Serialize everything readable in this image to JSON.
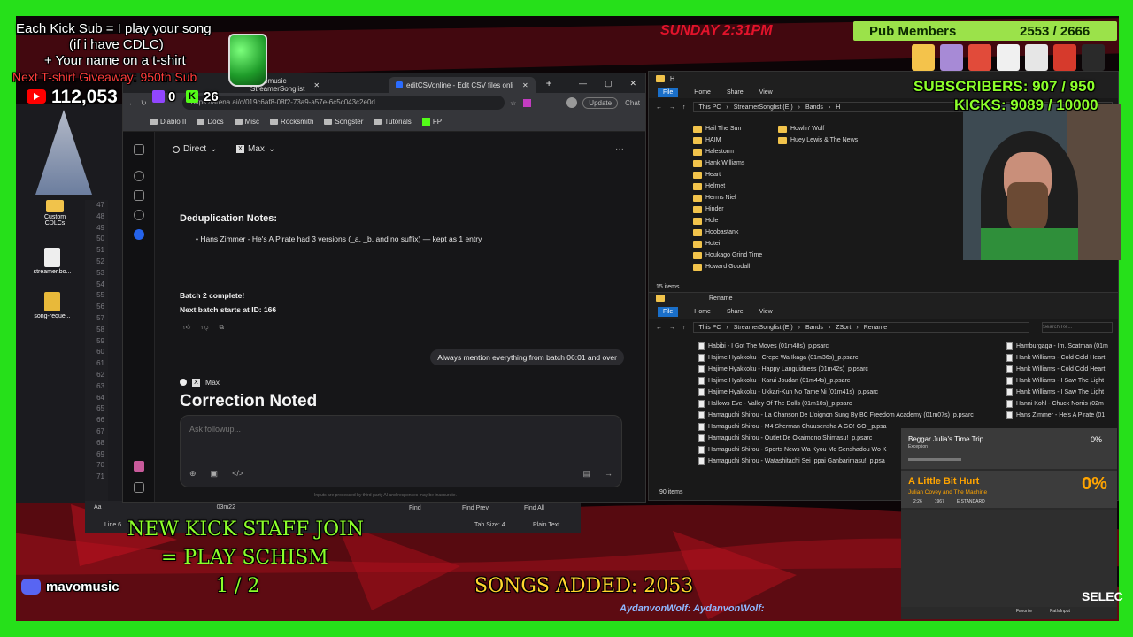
{
  "stream": {
    "kick_sub_line1": "Each Kick Sub = I play your song",
    "kick_sub_line2": "(if i have CDLC)",
    "tshirt_line": "+ Your name on a t-shirt",
    "giveaway_line": "Next T-shirt Giveaway: 950th Sub",
    "youtube_count": "112,053",
    "twitch_count": "0",
    "kick_count": "26",
    "day_time": "SUNDAY 2:31PM",
    "pub_members_label": "Pub Members",
    "pub_members_count": "2553 / 2666",
    "subscribers": "SUBSCRIBERS: 907 / 950",
    "kicks": "KICKS: 9089 / 10000",
    "promo_line1": "NEW KICK STAFF JOIN",
    "promo_line2": "= PLAY SCHISM",
    "promo_line3": "1 / 2",
    "songs_added": "SONGS ADDED: 2053",
    "channel_name": "mavomusic",
    "ticker": "AydanvonWolf: AydanvonWolf:",
    "select_label": "SELEC"
  },
  "desktop": {
    "icons": [
      {
        "label": "Custom CDLCs"
      },
      {
        "label": "streamer.bo..."
      },
      {
        "label": "song-reque..."
      }
    ],
    "editor": {
      "line_numbers": [
        "47",
        "48",
        "49",
        "50",
        "51",
        "52",
        "53",
        "54",
        "55",
        "56",
        "57",
        "58",
        "59",
        "60",
        "61",
        "62",
        "63",
        "64",
        "65",
        "66",
        "67",
        "68",
        "69",
        "70",
        "71"
      ],
      "find_time": "03m22",
      "find_label": "Find",
      "find_prev": "Find Prev",
      "find_all": "Find All",
      "status_line": "Line 6",
      "status_tab": "Tab Size: 4",
      "status_mode": "Plain Text"
    }
  },
  "browser": {
    "tabs": [
      {
        "title": "mavomusic | StreamerSonglist"
      },
      {
        "title": "editCSVonline - Edit CSV files onli"
      }
    ],
    "new_tab": "+",
    "url": "https://arena.ai/c/019c6af8-08f2-73a9-a57e-6c5c043c2e0d",
    "update_label": "Update",
    "chat_label": "Chat",
    "bookmarks": [
      "Diablo II",
      "Docs",
      "Misc",
      "Rocksmith",
      "Songster",
      "Tutorials",
      "FP"
    ],
    "mode_select": "Direct",
    "model_select": "Max",
    "dedup_heading": "Deduplication Notes:",
    "dedup_item": "Hans Zimmer - He's A Pirate had 3 versions (_a, _b, and no suffix) — kept as 1 entry",
    "batch_complete": "Batch 2 complete!",
    "next_batch": "Next batch starts at ID: 166",
    "user_message": "Always mention everything from batch 06:01 and over",
    "response_model": "Max",
    "response_heading": "Correction Noted",
    "input_placeholder": "Ask followup...",
    "disclaimer": "Inputs are processed by third-party AI and responses may be inaccurate."
  },
  "explorer1": {
    "tab_h": "H",
    "ribbon": [
      "File",
      "Home",
      "Share",
      "View"
    ],
    "breadcrumb": [
      "This PC",
      "StreamerSonglist (E:)",
      "Bands",
      "H"
    ],
    "col1": [
      "Hail The Sun",
      "HAIM",
      "Halestorm",
      "Hank Williams",
      "Heart",
      "Helmet",
      "Herms Niel",
      "Hinder",
      "Hole",
      "Hoobastank",
      "Hotei",
      "Houkago Grind Time",
      "Howard Goodall"
    ],
    "col2": [
      "Howlin' Wolf",
      "Huey Lewis & The News"
    ],
    "status": "15 items"
  },
  "explorer2": {
    "title": "Rename",
    "ribbon": [
      "File",
      "Home",
      "Share",
      "View"
    ],
    "breadcrumb": [
      "This PC",
      "StreamerSonglist (E:)",
      "Bands",
      "ZSort",
      "Rename"
    ],
    "search_placeholder": "Search Re...",
    "files": [
      "Habibi - I Got The Moves (01m48s)_p.psarc",
      "Hajime Hyakkoku - Crepe Wa Ikaga (01m36s)_p.psarc",
      "Hajime Hyakkoku - Happy Languidness (01m42s)_p.psarc",
      "Hajime Hyakkoku - Karui Joudan (01m44s)_p.psarc",
      "Hajime Hyakkoku - Ukkari-Kun No Tame Ni (01m41s)_p.psarc",
      "Hallows Eve - Valley Of The Dolls (01m10s)_p.psarc",
      "Hamaguchi Shirou - La Chanson De L'oignon Sung By BC Freedom Academy (01m07s)_p.psarc",
      "Hamaguchi Shirou - M4 Sherman Chuusensha A GO! GO!_p.psa",
      "Hamaguchi Shirou - Outlet De Okaimono Shimasu!_p.psarc",
      "Hamaguchi Shirou - Sports News Wa Kyou Mo Senshadou Wo K",
      "Hamaguchi Shirou - Watashitachi Sei Ippai Ganbarimasu!_p.psa"
    ],
    "files_right": [
      "Hamburgaga - Im. Scatman (01m",
      "Hank Williams - Cold Cold Heart",
      "Hank Williams - Cold Cold Heart",
      "Hank Williams - I Saw The Light",
      "Hank Williams - I Saw The Light",
      "Hanni Kohl - Chuck Norris (02m",
      "Hans Zimmer - He's A Pirate (01"
    ],
    "status": "90 items"
  },
  "song_widget": {
    "prev_title": "Beggar Julia's Time Trip",
    "prev_sub": "Exception",
    "prev_pct": "0%",
    "title": "A Little Bit Hurt",
    "artist": "Julian Covey and The Machine",
    "pct": "0%",
    "meta1": "2:26",
    "meta2": "1967",
    "tuning": "E STANDARD",
    "footer1": "Favorite",
    "footer2": "Path/Input"
  },
  "colors": {
    "green_screen": "#26e01a",
    "accent_red": "#e2132b",
    "lime_text": "#8cff2a",
    "song_orange": "#ffa400",
    "explorer_file_blue": "#1a6fc9"
  }
}
